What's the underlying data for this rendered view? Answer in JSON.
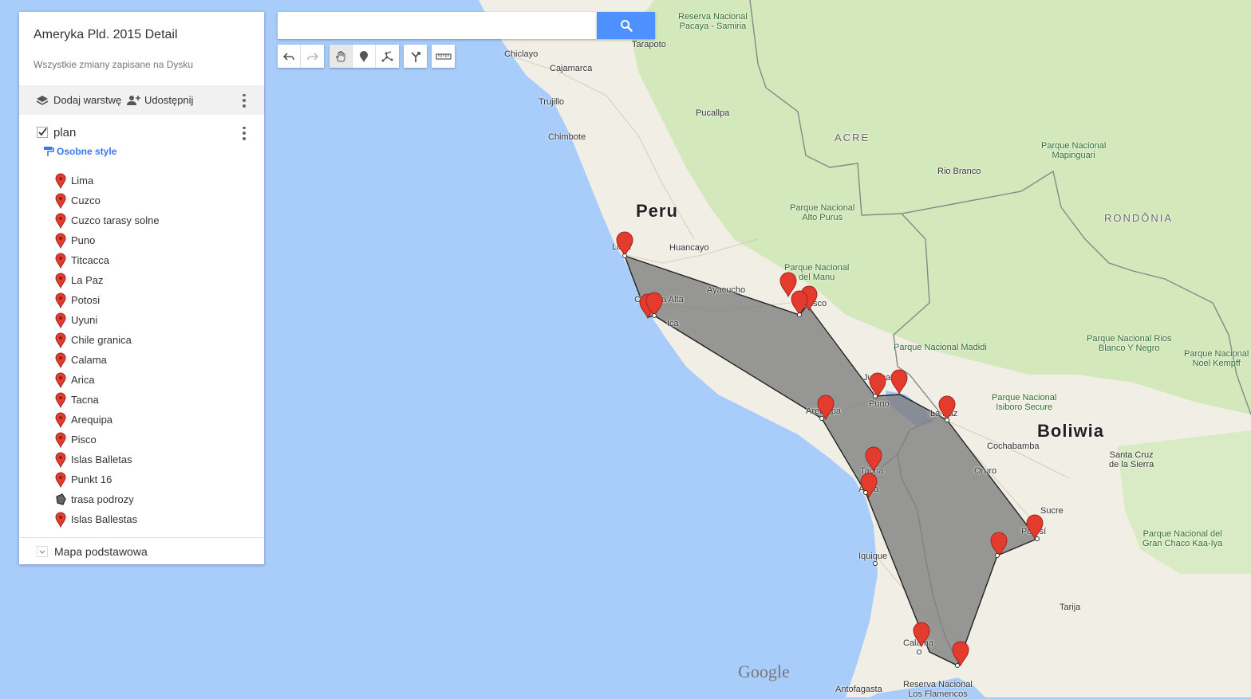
{
  "panel": {
    "title": "Ameryka Pld. 2015 Detail",
    "saved_status": "Wszystkie zmiany zapisane na Dysku",
    "add_layer_label": "Dodaj warstwę",
    "share_label": "Udostępnij",
    "layer": {
      "name": "plan",
      "checked": true,
      "style_link": "Osobne style",
      "items": [
        {
          "label": "Lima",
          "icon": "marker-icon"
        },
        {
          "label": "Cuzco",
          "icon": "marker-icon"
        },
        {
          "label": "Cuzco tarasy solne",
          "icon": "marker-icon"
        },
        {
          "label": "Puno",
          "icon": "marker-icon"
        },
        {
          "label": "Titcacca",
          "icon": "marker-icon"
        },
        {
          "label": "La Paz",
          "icon": "marker-icon"
        },
        {
          "label": "Potosi",
          "icon": "marker-icon"
        },
        {
          "label": "Uyuni",
          "icon": "marker-icon"
        },
        {
          "label": "Chile granica",
          "icon": "marker-icon"
        },
        {
          "label": "Calama",
          "icon": "marker-icon"
        },
        {
          "label": "Arica",
          "icon": "marker-icon"
        },
        {
          "label": "Tacna",
          "icon": "marker-icon"
        },
        {
          "label": "Arequipa",
          "icon": "marker-icon"
        },
        {
          "label": "Pisco",
          "icon": "marker-icon"
        },
        {
          "label": "Islas Balletas",
          "icon": "marker-icon"
        },
        {
          "label": "Punkt 16",
          "icon": "marker-icon"
        },
        {
          "label": "trasa podrozy",
          "icon": "polygon-icon"
        },
        {
          "label": "Islas Ballestas",
          "icon": "marker-icon"
        }
      ]
    },
    "base_map_label": "Mapa podstawowa"
  },
  "search": {
    "value": "",
    "placeholder": ""
  },
  "map": {
    "labels": {
      "reserva_pacaya": "Reserva Nacional\nPacaya - Samiria",
      "chiclayo": "Chiclayo",
      "tarapoto": "Tarapoto",
      "cajamarca": "Cajamarca",
      "trujillo": "Trujillo",
      "pucallpa": "Pucallpa",
      "chimbote": "Chimbote",
      "acre": "ACRE",
      "mapinguari": "Parque Nacional\nMapinguari",
      "rio_branco": "Rio Branco",
      "alto_purus": "Parque Nacional\nAlto Purus",
      "peru": "Peru",
      "rondonia": "RONDÔNIA",
      "lima": "Lima",
      "huancayo": "Huancayo",
      "del_manu": "Parque Nacional\ndel Manu",
      "ayacucho": "Ayacucho",
      "chincha_alta": "Chincha Alta",
      "cusco": "Cusco",
      "ica": "Ica",
      "madidi": "Parque Nacional Madidi",
      "rios_blanco": "Parque Nacional Rios\nBlanco Y Negro",
      "noel_kempff": "Parque Nacional\nNoel Kempff",
      "juliaca": "Juliaca",
      "puno": "Puno",
      "isiboro": "Parque Nacional\nIsiboro Secure",
      "la_paz": "La Paz",
      "bolivia": "Boliwia",
      "arequipa": "Arequipa",
      "cochabamba": "Cochabamba",
      "santa_cruz": "Santa Cruz\nde la Sierra",
      "tacna": "Tacna",
      "oruro": "Oruro",
      "arica": "Arica",
      "sucre": "Sucre",
      "potosi": "Potosí",
      "gran_chaco": "Parque Nacional del\nGran Chaco Kaa-Iya",
      "iquique": "Iquique",
      "tarija": "Tarija",
      "calama": "Calama",
      "antofagasta": "Antofagasta",
      "flamencos": "Reserva Nacional\nLos Flamencos"
    },
    "logo": "Google",
    "colors": {
      "water": "#a8cdfb",
      "land": "#f2efe6",
      "forest": "#cfe6b5",
      "marker": "#e33b2e",
      "route_fill": "#808080"
    }
  }
}
